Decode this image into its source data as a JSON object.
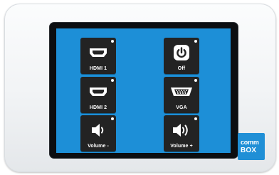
{
  "buttons": {
    "hdmi1": {
      "label": "HDMI 1",
      "icon": "hdmi-port-icon"
    },
    "off": {
      "label": "Off",
      "icon": "power-icon"
    },
    "hdmi2": {
      "label": "HDMI 2",
      "icon": "hdmi-port-icon"
    },
    "vga": {
      "label": "VGA",
      "icon": "vga-port-icon"
    },
    "volume_down": {
      "label": "Volume -",
      "icon": "speaker-low-icon"
    },
    "volume_up": {
      "label": "Volume +",
      "icon": "speaker-high-icon"
    }
  },
  "brand": {
    "line1": "comm",
    "line2": "BOX"
  },
  "colors": {
    "screen": "#1d8fd7",
    "button": "#232323",
    "logo": "#1f8fd6"
  }
}
